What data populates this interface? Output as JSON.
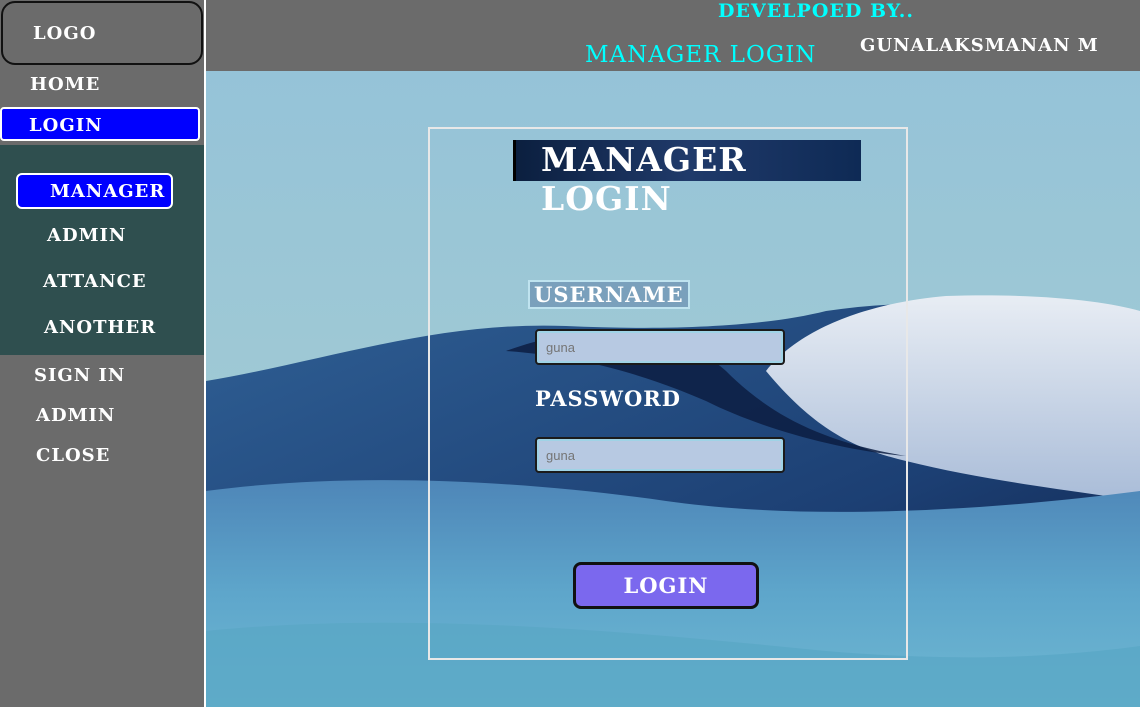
{
  "sidebar": {
    "logo": "LOGO",
    "home": "HOME",
    "login": "LOGIN",
    "submenu": {
      "manager": "MANAGER",
      "admin": "ADMIN",
      "attance": "ATTANCE",
      "another": "ANOTHER"
    },
    "sign_in": "SIGN IN",
    "admin": "ADMIN",
    "close": "CLOSE"
  },
  "header": {
    "developed_by": "DEVELPOED BY..",
    "title": "MANAGER LOGIN",
    "developer": "GUNALAKSMANAN M"
  },
  "form": {
    "title": "MANAGER LOGIN",
    "username_label": "USERNAME",
    "username_value": "guna",
    "password_label": "PASSWORD",
    "password_value": "guna",
    "login_button": "LOGIN"
  },
  "colors": {
    "sidebar_bg": "#6b6b6b",
    "submenu_bg": "#2f4f4f",
    "active_blue": "#0000ff",
    "header_cyan": "#00ffff",
    "button_purple": "#7b68ee",
    "field_bg": "#b7c9e2"
  }
}
